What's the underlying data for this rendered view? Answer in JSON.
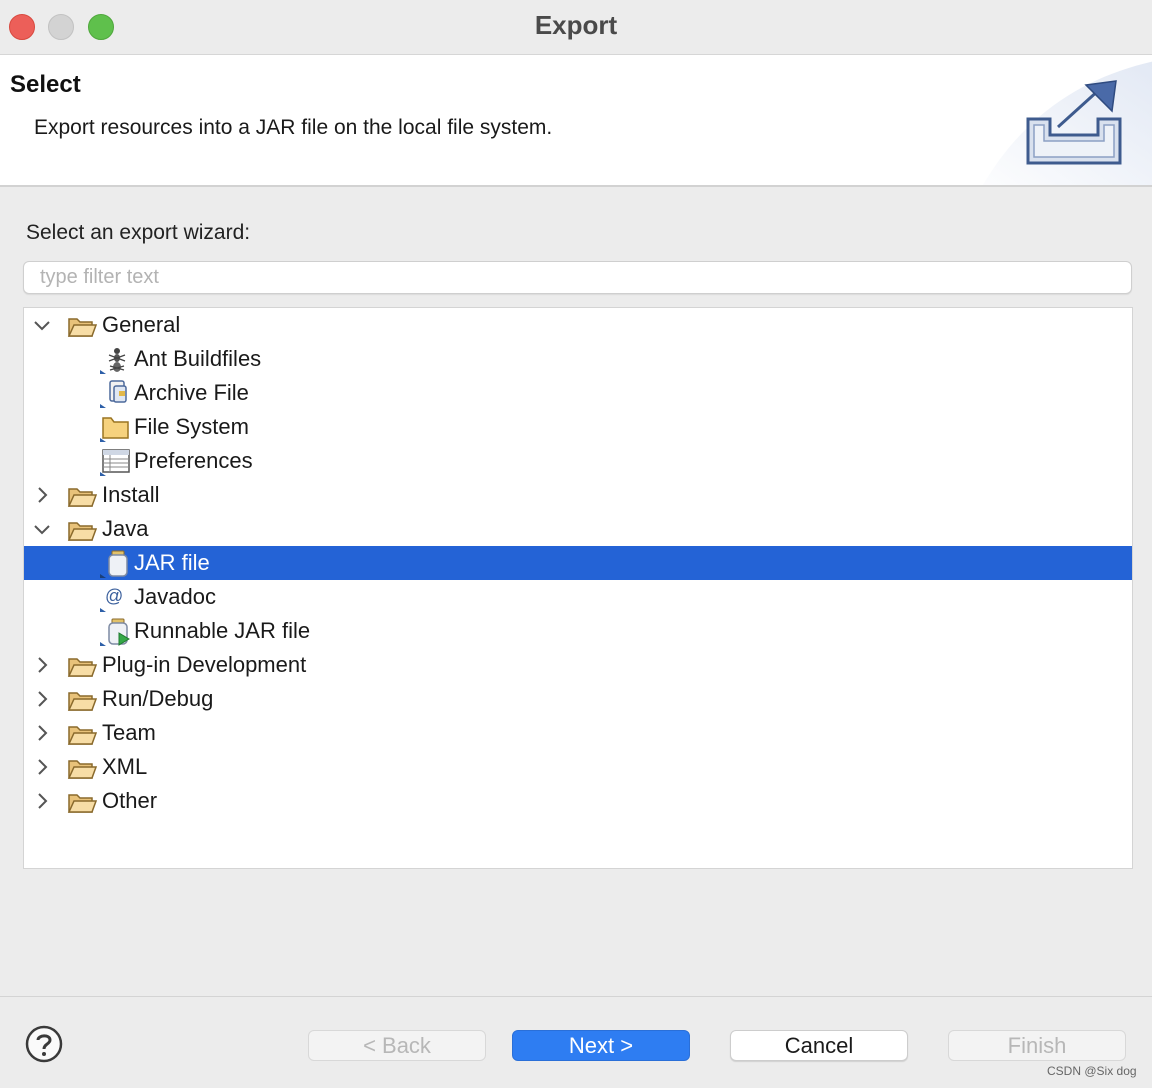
{
  "window": {
    "title": "Export"
  },
  "banner": {
    "title": "Select",
    "description": "Export resources into a JAR file on the local file system.",
    "icon": "export-icon"
  },
  "prompt": "Select an export wizard:",
  "filter": {
    "placeholder": "type filter text",
    "value": ""
  },
  "tree": {
    "items": [
      {
        "label": "General",
        "level": 0,
        "expanded": true,
        "icon": "folder-open-icon"
      },
      {
        "label": "Ant Buildfiles",
        "level": 1,
        "icon": "ant-icon"
      },
      {
        "label": "Archive File",
        "level": 1,
        "icon": "archive-icon"
      },
      {
        "label": "File System",
        "level": 1,
        "icon": "folder-icon"
      },
      {
        "label": "Preferences",
        "level": 1,
        "icon": "preferences-icon"
      },
      {
        "label": "Install",
        "level": 0,
        "expanded": false,
        "icon": "folder-open-icon"
      },
      {
        "label": "Java",
        "level": 0,
        "expanded": true,
        "icon": "folder-open-icon"
      },
      {
        "label": "JAR file",
        "level": 1,
        "icon": "jar-icon",
        "selected": true
      },
      {
        "label": "Javadoc",
        "level": 1,
        "icon": "javadoc-icon"
      },
      {
        "label": "Runnable JAR file",
        "level": 1,
        "icon": "runnable-jar-icon"
      },
      {
        "label": "Plug-in Development",
        "level": 0,
        "expanded": false,
        "icon": "folder-open-icon"
      },
      {
        "label": "Run/Debug",
        "level": 0,
        "expanded": false,
        "icon": "folder-open-icon"
      },
      {
        "label": "Team",
        "level": 0,
        "expanded": false,
        "icon": "folder-open-icon"
      },
      {
        "label": "XML",
        "level": 0,
        "expanded": false,
        "icon": "folder-open-icon"
      },
      {
        "label": "Other",
        "level": 0,
        "expanded": false,
        "icon": "folder-open-icon"
      }
    ]
  },
  "buttons": {
    "back": "< Back",
    "next": "Next >",
    "cancel": "Cancel",
    "finish": "Finish"
  },
  "watermark": "CSDN @Six dog",
  "colors": {
    "selection": "#2463d6",
    "primary_button": "#2e7df2"
  }
}
